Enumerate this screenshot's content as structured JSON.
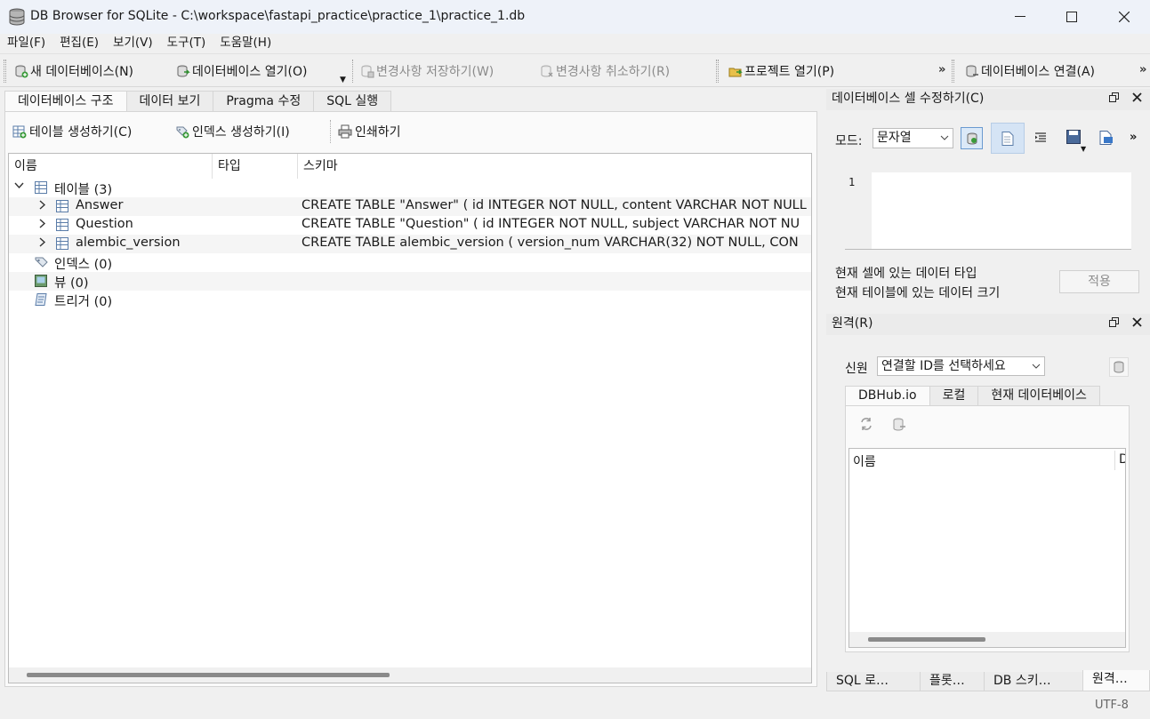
{
  "window": {
    "title": "DB Browser for SQLite - C:\\workspace\\fastapi_practice\\practice_1\\practice_1.db"
  },
  "menu": [
    "파일(F)",
    "편집(E)",
    "보기(V)",
    "도구(T)",
    "도움말(H)"
  ],
  "toolbar": {
    "new_db": "새 데이터베이스(N)",
    "open_db": "데이터베이스 열기(O)",
    "write_changes": "변경사항 저장하기(W)",
    "revert_changes": "변경사항 취소하기(R)",
    "open_project": "프로젝트 열기(P)",
    "attach_db": "데이터베이스 연결(A)",
    "more": "»"
  },
  "tabs": [
    "데이터베이스 구조",
    "데이터 보기",
    "Pragma 수정",
    "SQL 실행"
  ],
  "structure_toolbar": {
    "create_table": "테이블 생성하기(C)",
    "create_index": "인덱스 생성하기(I)",
    "print": "인쇄하기"
  },
  "tree": {
    "columns": [
      "이름",
      "타입",
      "스키마"
    ],
    "tables_label": "테이블 (3)",
    "tables": [
      {
        "name": "Answer",
        "schema": "CREATE TABLE \"Answer\" ( id INTEGER NOT NULL, content VARCHAR NOT NULL"
      },
      {
        "name": "Question",
        "schema": "CREATE TABLE \"Question\" ( id INTEGER NOT NULL, subject VARCHAR NOT NU"
      },
      {
        "name": "alembic_version",
        "schema": "CREATE TABLE alembic_version ( version_num VARCHAR(32) NOT NULL, CON"
      }
    ],
    "indices_label": "인덱스 (0)",
    "views_label": "뷰 (0)",
    "triggers_label": "트리거 (0)"
  },
  "edit_cell": {
    "title": "데이터베이스 셀 수정하기(C)",
    "mode_label": "모드:",
    "mode_value": "문자열",
    "line_number": "1",
    "type_label": "현재 셀에 있는 데이터 타입",
    "size_label": "현재 테이블에 있는 데이터 크기",
    "apply": "적용"
  },
  "remote": {
    "title": "원격(R)",
    "identity_label": "신원",
    "identity_value": "연결할 ID를 선택하세요",
    "tabs": [
      "DBHub.io",
      "로컬",
      "현재 데이터베이스"
    ],
    "column_name": "이름",
    "column_partial": "D"
  },
  "dock_tabs": [
    "SQL 로…",
    "플롯…",
    "DB 스키…",
    "원격…"
  ],
  "status": {
    "encoding": "UTF-8"
  }
}
